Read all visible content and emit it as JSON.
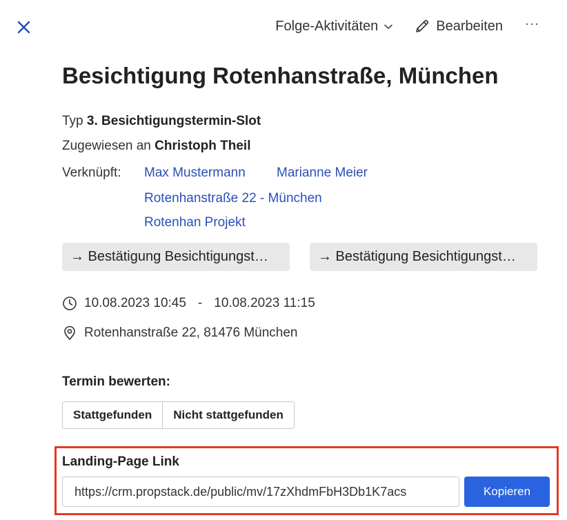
{
  "header": {
    "close_icon": "close-icon",
    "folge_label": "Folge-Aktivitäten",
    "edit_label": "Bearbeiten",
    "more_label": "···"
  },
  "activity": {
    "title": "Besichtigung Rotenhanstraße, München",
    "type_label": "Typ",
    "type_value": "3. Besichtigungstermin-Slot",
    "assigned_label": "Zugewiesen an",
    "assigned_value": "Christoph Theil",
    "linked_label": "Verknüpft:",
    "links": [
      "Max Mustermann",
      "Marianne Meier",
      "Rotenhanstraße 22 - München",
      "Rotenhan Projekt"
    ]
  },
  "actions": [
    {
      "label": "→ Bestätigung Besichtigungst…"
    },
    {
      "label": "→ Bestätigung Besichtigungst…"
    }
  ],
  "schedule": {
    "start": "10.08.2023 10:45",
    "separator": "-",
    "end": "10.08.2023 11:15",
    "location": "Rotenhanstraße 22, 81476 München"
  },
  "rating": {
    "label": "Termin bewerten:",
    "options": [
      "Stattgefunden",
      "Nicht stattgefunden"
    ]
  },
  "landing_page": {
    "label": "Landing-Page Link",
    "url": "https://crm.propstack.de/public/mv/17zXhdmFbH3Db1K7acs",
    "copy_label": "Kopieren"
  },
  "colors": {
    "link": "#2a4fb8",
    "primary_button": "#2a63e0",
    "highlight_border": "#e03a24",
    "close_icon": "#2a4fb8"
  }
}
